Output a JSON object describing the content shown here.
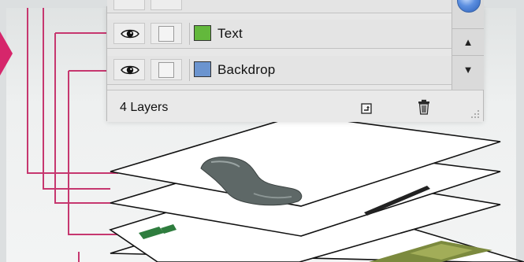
{
  "layers_panel": {
    "layers": [
      {
        "name": "Text",
        "swatch_color": "#63b83c"
      },
      {
        "name": "Backdrop",
        "swatch_color": "#6b94cf"
      }
    ],
    "footer": {
      "layer_count": "4 Layers"
    }
  },
  "icons": {
    "visibility": "eye-icon",
    "lock": "lock-toggle",
    "new_layer": "new-layer-icon",
    "delete": "trash-icon",
    "scroll_up": "arrow-up-icon",
    "scroll_down": "arrow-down-icon",
    "resize": "resize-grip-icon"
  },
  "colors": {
    "connector_lines": "#c6376f",
    "callout_arrow": "#d6266b",
    "scroll_thumb": "#2b5fb8"
  }
}
